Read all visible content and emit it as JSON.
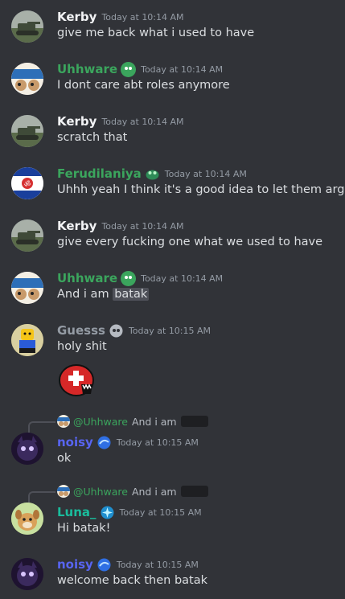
{
  "messages": [
    {
      "author": "Kerby",
      "timestamp": "Today at 10:14 AM",
      "text": "give me back what i used to have",
      "name_color": "#f2f3f5",
      "avatar_icon": "tank-avatar"
    },
    {
      "author": "Uhhware",
      "timestamp": "Today at 10:14 AM",
      "text": "I dont care abt roles anymore",
      "name_color": "#3ba55d",
      "avatar_icon": "olive-joy-avatar",
      "badge_icon": "green-blob-badge"
    },
    {
      "author": "Kerby",
      "timestamp": "Today at 10:14 AM",
      "text": "scratch that",
      "name_color": "#f2f3f5",
      "avatar_icon": "tank-avatar"
    },
    {
      "author": "Ferudilaniya",
      "timestamp": "Today at 10:14 AM",
      "text": "Uhhh yeah I think it's a good idea to let them argue",
      "name_color": "#3ba55d",
      "avatar_icon": "flag-avatar",
      "badge_icon": "green-creature-badge"
    },
    {
      "author": "Kerby",
      "timestamp": "Today at 10:14 AM",
      "text": "give every fucking one what we used to have",
      "name_color": "#f2f3f5",
      "avatar_icon": "tank-avatar"
    },
    {
      "author": "Uhhware",
      "timestamp": "Today at 10:14 AM",
      "text_before": "And i am ",
      "text_spoiler": "batak",
      "name_color": "#3ba55d",
      "avatar_icon": "olive-joy-avatar",
      "badge_icon": "green-blob-badge"
    },
    {
      "author": "Guesss",
      "timestamp": "Today at 10:15 AM",
      "text": "holy shit",
      "name_color": "#949ba4",
      "avatar_icon": "lego-avatar",
      "badge_icon": "grey-skull-badge",
      "sticker_icon": "red-ball-sticker"
    },
    {
      "reply_to": "@Uhhware",
      "reply_text": "And i am",
      "author": "noisy",
      "timestamp": "Today at 10:15 AM",
      "text": "ok",
      "name_color": "#5865f2",
      "avatar_icon": "purple-cat-avatar",
      "badge_icon": "blue-wave-badge"
    },
    {
      "reply_to": "@Uhhware",
      "reply_text": "And i am",
      "author": "Luna_",
      "timestamp": "Today at 10:15 AM",
      "text": "Hi batak!",
      "name_color": "#1abc9c",
      "avatar_icon": "dog-avatar",
      "badge_icon": "blue-sparkle-badge"
    },
    {
      "author": "noisy",
      "timestamp": "Today at 10:15 AM",
      "text": "welcome back then batak",
      "name_color": "#5865f2",
      "avatar_icon": "purple-cat-avatar",
      "badge_icon": "blue-wave-badge"
    }
  ]
}
